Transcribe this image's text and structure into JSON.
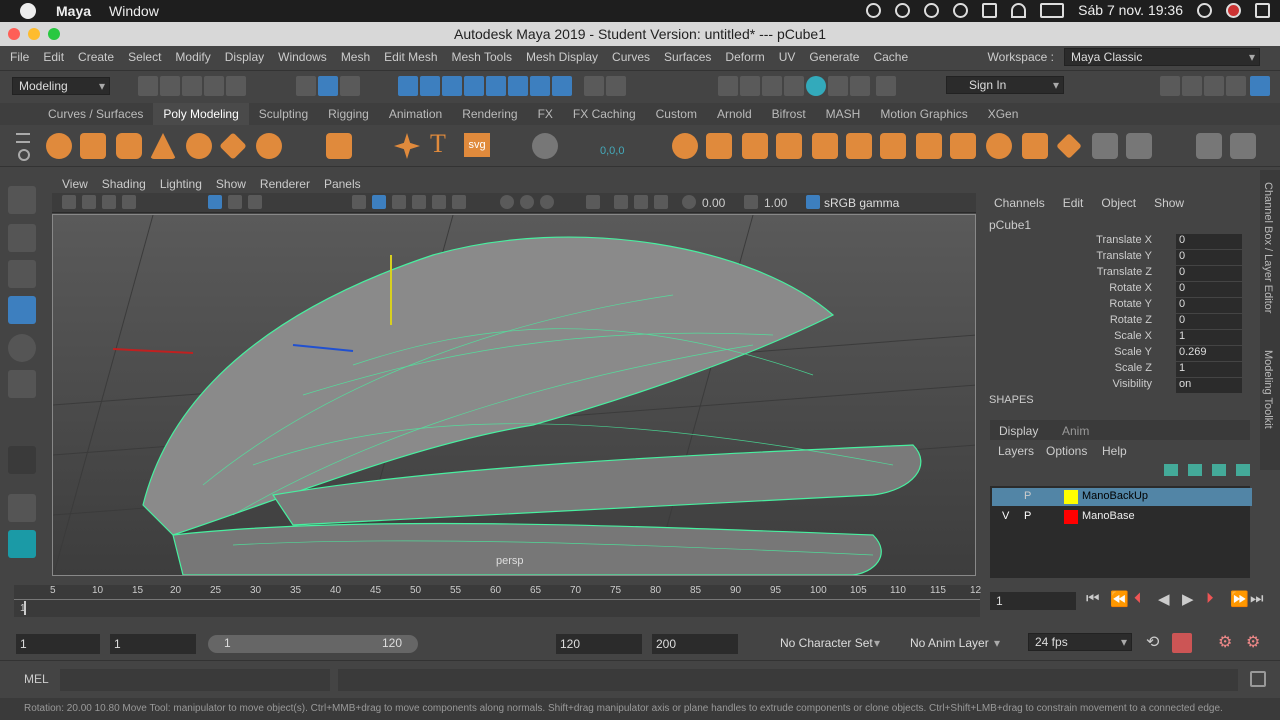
{
  "mac": {
    "app": "Maya",
    "menu_items": [
      "Window"
    ],
    "datetime": "Sáb 7 nov.  19:36"
  },
  "title": "Autodesk Maya 2019 - Student Version: untitled*   ---   pCube1",
  "menus": [
    "File",
    "Edit",
    "Create",
    "Select",
    "Modify",
    "Display",
    "Windows",
    "Mesh",
    "Edit Mesh",
    "Mesh Tools",
    "Mesh Display",
    "Curves",
    "Surfaces",
    "Deform",
    "UV",
    "Generate",
    "Cache"
  ],
  "workspace": {
    "label": "Workspace :",
    "value": "Maya Classic"
  },
  "status": {
    "mode": "Modeling",
    "sign_in": "Sign In"
  },
  "shelf_tabs": [
    "Curves / Surfaces",
    "Poly Modeling",
    "Sculpting",
    "Rigging",
    "Animation",
    "Rendering",
    "FX",
    "FX Caching",
    "Custom",
    "Arnold",
    "Bifrost",
    "MASH",
    "Motion Graphics",
    "XGen"
  ],
  "shelf_active": "Poly Modeling",
  "shelf_text_icons": {
    "type": "T",
    "svg": "svg",
    "coord": "0,0,0"
  },
  "viewport": {
    "menu": [
      "View",
      "Shading",
      "Lighting",
      "Show",
      "Renderer",
      "Panels"
    ],
    "exposure": "0.00",
    "gamma": "1.00",
    "colorspace": "sRGB gamma",
    "camera": "persp"
  },
  "channelbox": {
    "menu": [
      "Channels",
      "Edit",
      "Object",
      "Show"
    ],
    "object": "pCube1",
    "attrs": [
      {
        "name": "Translate X",
        "value": "0"
      },
      {
        "name": "Translate Y",
        "value": "0"
      },
      {
        "name": "Translate Z",
        "value": "0"
      },
      {
        "name": "Rotate X",
        "value": "0"
      },
      {
        "name": "Rotate Y",
        "value": "0"
      },
      {
        "name": "Rotate Z",
        "value": "0"
      },
      {
        "name": "Scale X",
        "value": "1"
      },
      {
        "name": "Scale Y",
        "value": "0.269"
      },
      {
        "name": "Scale Z",
        "value": "1"
      },
      {
        "name": "Visibility",
        "value": "on"
      }
    ],
    "shapes_label": "SHAPES"
  },
  "layers": {
    "tabs": [
      "Display",
      "Anim"
    ],
    "menu": [
      "Layers",
      "Options",
      "Help"
    ],
    "rows": [
      {
        "v": "",
        "p": "P",
        "name": "ManoBackUp",
        "color": "#ffff00",
        "selected": true
      },
      {
        "v": "V",
        "p": "P",
        "name": "ManoBase",
        "color": "#ff0000",
        "selected": false
      }
    ]
  },
  "vtabs": [
    "Channel Box / Layer Editor",
    "Modeling Toolkit"
  ],
  "timeline": {
    "ticks": [
      "5",
      "10",
      "15",
      "20",
      "25",
      "30",
      "35",
      "40",
      "45",
      "50",
      "55",
      "60",
      "65",
      "70",
      "75",
      "80",
      "85",
      "90",
      "95",
      "100",
      "105",
      "110",
      "115",
      "12"
    ],
    "start_marker": "1",
    "current_frame": "1"
  },
  "range": {
    "start": "1",
    "anim_start": "1",
    "slider_start": "1",
    "slider_end": "120",
    "end": "120",
    "anim_end": "200",
    "character_set": "No Character Set",
    "anim_layer": "No Anim Layer",
    "fps": "24 fps"
  },
  "cmd": {
    "lang": "MEL"
  },
  "helpline": "Rotation:  20.00   10.80    Move Tool: manipulator to move object(s). Ctrl+MMB+drag to move components along normals. Shift+drag manipulator axis or plane handles to extrude components or clone objects. Ctrl+Shift+LMB+drag to constrain movement to a connected edge.",
  "colors": {
    "accent": "#3d7fbf",
    "wire": "#48f0a0"
  }
}
